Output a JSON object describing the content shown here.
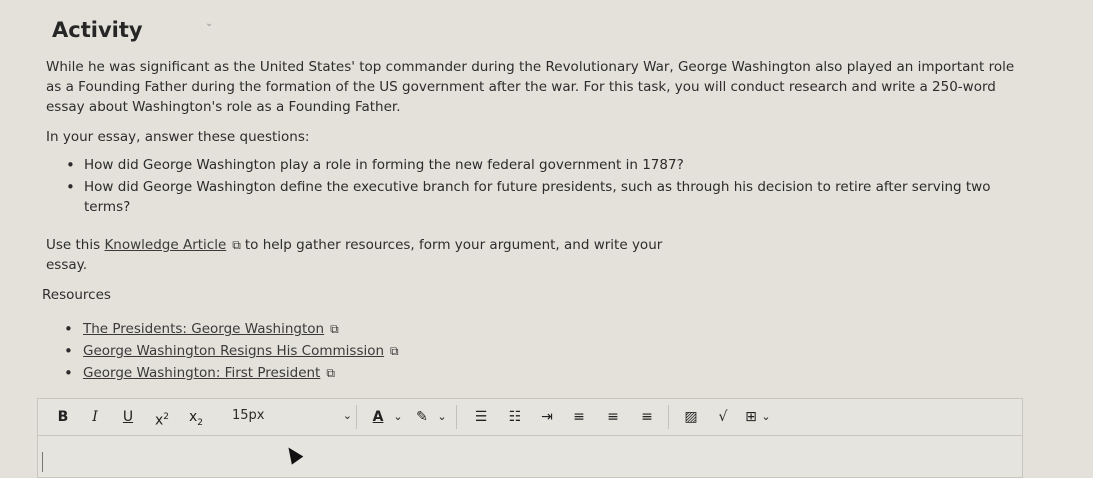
{
  "activity": {
    "title": "Activity",
    "intro": "While he was significant as the United States' top commander during the Revolutionary War, George Washington also played an important role as a Founding Father during the formation of the US government after the war. For this task, you will conduct research and write a 250-word essay about Washington's role as a Founding Father.",
    "prompt": "In your essay, answer these questions:",
    "questions": [
      "How did George Washington play a role in forming the new federal government in 1787?",
      "How did George Washington define the executive branch for future presidents, such as through his decision to retire after serving two terms?"
    ],
    "use_prefix": "Use this",
    "use_link": "Knowledge Article",
    "use_suffix": "to help gather resources, form your argument, and write your essay.",
    "resources_heading": "Resources",
    "resources": [
      "The Presidents: George Washington",
      "George Washington Resigns His Commission",
      "George Washington: First President"
    ]
  },
  "editor": {
    "toolbar": {
      "bold": "B",
      "italic": "I",
      "underline": "U",
      "superscript": "x",
      "subscript": "x",
      "font_size": "15px"
    },
    "content": ""
  },
  "icons": {
    "external_link": "external-link-icon"
  }
}
